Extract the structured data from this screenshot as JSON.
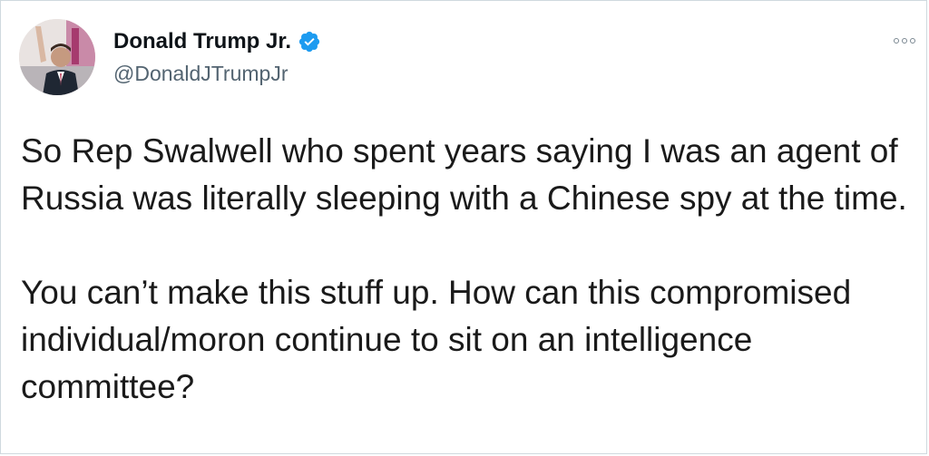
{
  "author": {
    "name": "Donald Trump Jr.",
    "handle": "@DonaldJTrumpJr",
    "verified": true,
    "verified_color": "#1d9bf0"
  },
  "menu": {
    "icon": "more-options-icon"
  },
  "tweet": {
    "paragraphs": [
      "So Rep Swalwell who spent years saying I was an agent of Russia was literally sleeping with a Chinese spy at the time.",
      "You can’t make this stuff up. How can this compromised individual/moron continue to sit on an intelligence committee?"
    ]
  },
  "colors": {
    "text": "#0f1419",
    "secondary": "#536471",
    "border": "#cfd9de"
  }
}
